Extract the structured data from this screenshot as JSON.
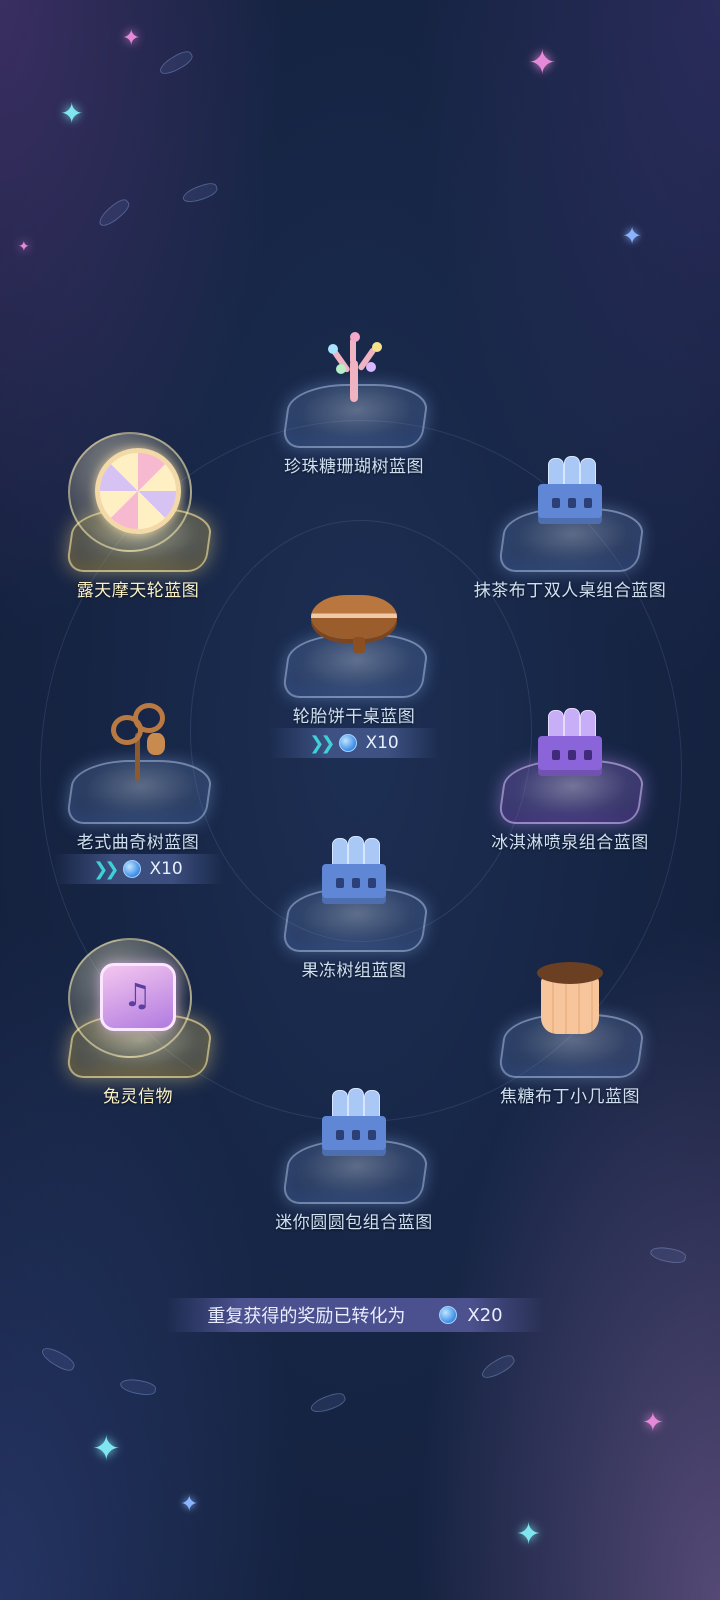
{
  "rewards": [
    {
      "name": "珍珠糖珊瑚树蓝图",
      "style": "blue",
      "art": "coral-tree"
    },
    {
      "name": "露天摩天轮蓝图",
      "style": "gold",
      "art": "ferris-wheel"
    },
    {
      "name": "抹茶布丁双人桌组合蓝图",
      "style": "blue",
      "art": "blueprint-box"
    },
    {
      "name": "轮胎饼干桌蓝图",
      "style": "blue",
      "art": "cookie-table",
      "duplicate": {
        "count": "X10"
      }
    },
    {
      "name": "老式曲奇树蓝图",
      "style": "blue",
      "art": "cookie-tree",
      "duplicate": {
        "count": "X10"
      }
    },
    {
      "name": "冰淇淋喷泉组合蓝图",
      "style": "purple",
      "art": "blueprint-box"
    },
    {
      "name": "果冻树组蓝图",
      "style": "blue",
      "art": "blueprint-box"
    },
    {
      "name": "兔灵信物",
      "style": "gold",
      "art": "rabbit-token"
    },
    {
      "name": "焦糖布丁小几蓝图",
      "style": "blue",
      "art": "pudding-stool"
    },
    {
      "name": "迷你圆圆包组合蓝图",
      "style": "blue",
      "art": "blueprint-box"
    }
  ],
  "footer": {
    "text": "重复获得的奖励已转化为",
    "count": "X20",
    "currency_icon": "blue-gem-icon"
  },
  "colors": {
    "background": "#172646",
    "label": "#cfe0f2",
    "gold_label": "#fbf2c6",
    "chevron": "#3fd1d8"
  }
}
